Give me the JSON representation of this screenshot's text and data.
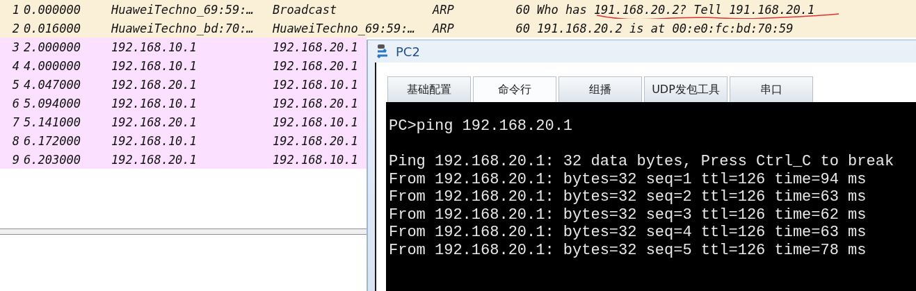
{
  "packets": [
    {
      "no": "1",
      "time": "0.000000",
      "source": "HuaweiTechno_69:59:…",
      "destination": "Broadcast",
      "protocol": "ARP",
      "length": "60",
      "info": "Who has 191.168.20.2? Tell 191.168.20.1",
      "color": "#faf0d7"
    },
    {
      "no": "2",
      "time": "0.016000",
      "source": "HuaweiTechno_bd:70:…",
      "destination": "HuaweiTechno_69:59:…",
      "protocol": "ARP",
      "length": "60",
      "info": "191.168.20.2 is at 00:e0:fc:bd:70:59",
      "color": "#faf0d7"
    },
    {
      "no": "3",
      "time": "2.000000",
      "source": "192.168.10.1",
      "destination": "192.168.20.1",
      "color": "#fce0ff"
    },
    {
      "no": "4",
      "time": "4.000000",
      "source": "192.168.10.1",
      "destination": "192.168.20.1",
      "color": "#fce0ff"
    },
    {
      "no": "5",
      "time": "4.047000",
      "source": "192.168.20.1",
      "destination": "192.168.10.1",
      "color": "#fce0ff"
    },
    {
      "no": "6",
      "time": "5.094000",
      "source": "192.168.10.1",
      "destination": "192.168.20.1",
      "color": "#fce0ff"
    },
    {
      "no": "7",
      "time": "5.141000",
      "source": "192.168.20.1",
      "destination": "192.168.10.1",
      "color": "#fce0ff"
    },
    {
      "no": "8",
      "time": "6.172000",
      "source": "192.168.10.1",
      "destination": "192.168.20.1",
      "color": "#fce0ff"
    },
    {
      "no": "9",
      "time": "6.203000",
      "source": "192.168.20.1",
      "destination": "192.168.10.1",
      "color": "#fce0ff"
    }
  ],
  "pc_window": {
    "title": "PC2",
    "tabs": [
      {
        "label": "基础配置",
        "selected": false
      },
      {
        "label": "命令行",
        "selected": true
      },
      {
        "label": "组播",
        "selected": false
      },
      {
        "label": "UDP发包工具",
        "selected": false
      },
      {
        "label": "串口",
        "selected": false
      }
    ],
    "terminal": [
      [
        "PC>ping 192.168.20.1"
      ],
      [
        "Ping 192.168.20.1: 32 data bytes, Press Ctrl_C to break",
        "From 192.168.20.1: bytes=32 seq=1 ttl=126 time=94 ms",
        "From 192.168.20.1: bytes=32 seq=2 ttl=126 time=63 ms",
        "From 192.168.20.1: bytes=32 seq=3 ttl=126 time=62 ms",
        "From 192.168.20.1: bytes=32 seq=4 ttl=126 time=63 ms",
        "From 192.168.20.1: bytes=32 seq=5 ttl=126 time=78 ms"
      ]
    ]
  }
}
